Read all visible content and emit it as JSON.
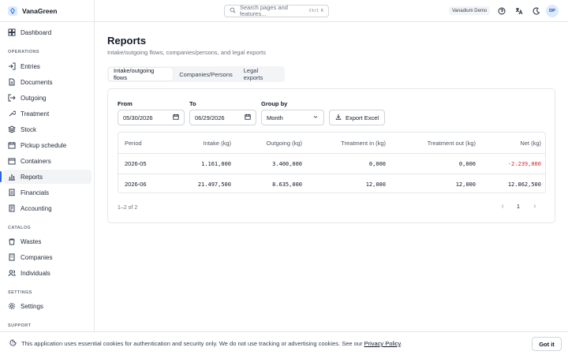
{
  "app": {
    "name": "VanaGreen"
  },
  "sidebar": {
    "items": [
      {
        "label": "Dashboard",
        "icon": "dashboard-icon"
      },
      {
        "label": "Entries",
        "icon": "login-icon"
      },
      {
        "label": "Documents",
        "icon": "document-icon"
      },
      {
        "label": "Outgoing",
        "icon": "logout-icon"
      },
      {
        "label": "Treatment",
        "icon": "wrench-icon"
      },
      {
        "label": "Stock",
        "icon": "stack-icon"
      },
      {
        "label": "Pickup schedule",
        "icon": "calendar-icon"
      },
      {
        "label": "Containers",
        "icon": "box-icon"
      },
      {
        "label": "Reports",
        "icon": "chart-icon"
      },
      {
        "label": "Financials",
        "icon": "receipt-icon"
      },
      {
        "label": "Accounting",
        "icon": "ledger-icon"
      },
      {
        "label": "Wastes",
        "icon": "recycle-icon"
      },
      {
        "label": "Companies",
        "icon": "building-icon"
      },
      {
        "label": "Individuals",
        "icon": "users-icon"
      },
      {
        "label": "Settings",
        "icon": "gear-icon"
      }
    ],
    "sections": {
      "operations": "OPERATIONS",
      "catalog": "CATALOG",
      "settings": "SETTINGS",
      "support": "SUPPORT"
    },
    "active": "Reports"
  },
  "topbar": {
    "search_placeholder": "Search pages and features...",
    "shortcut": "Ctrl K",
    "org": "Vanadium Demo",
    "avatar_initials": "DP"
  },
  "page": {
    "title": "Reports",
    "subtitle": "Intake/outgoing flows, companies/persons, and legal exports",
    "tabs": [
      "Intake/outgoing flows",
      "Companies/Persons",
      "Legal exports"
    ],
    "active_tab": "Intake/outgoing flows"
  },
  "filters": {
    "from_label": "From",
    "from_value": "05/30/2026",
    "to_label": "To",
    "to_value": "06/29/2026",
    "group_label": "Group by",
    "group_value": "Month",
    "export_label": "Export Excel"
  },
  "table": {
    "columns": [
      "Period",
      "Intake (kg)",
      "Outgoing (kg)",
      "Treatment in (kg)",
      "Treatment out (kg)",
      "Net (kg)"
    ],
    "rows": [
      [
        "2026-05",
        "1.161,000",
        "3.400,000",
        "0,000",
        "0,000",
        "-2.239,000"
      ],
      [
        "2026-06",
        "21.497,500",
        "8.635,000",
        "12,000",
        "12,000",
        "12.862,500"
      ]
    ]
  },
  "pagination": {
    "summary": "1–2 of 2",
    "current_page": "1"
  },
  "cookie_banner": {
    "text": "This application uses essential cookies for authentication and security only. We do not use tracking or advertising cookies. See our",
    "link": "Privacy Policy",
    "suffix": ".",
    "button": "Got it"
  },
  "colors": {
    "accent": "#2563eb",
    "negative": "#dc2626"
  }
}
